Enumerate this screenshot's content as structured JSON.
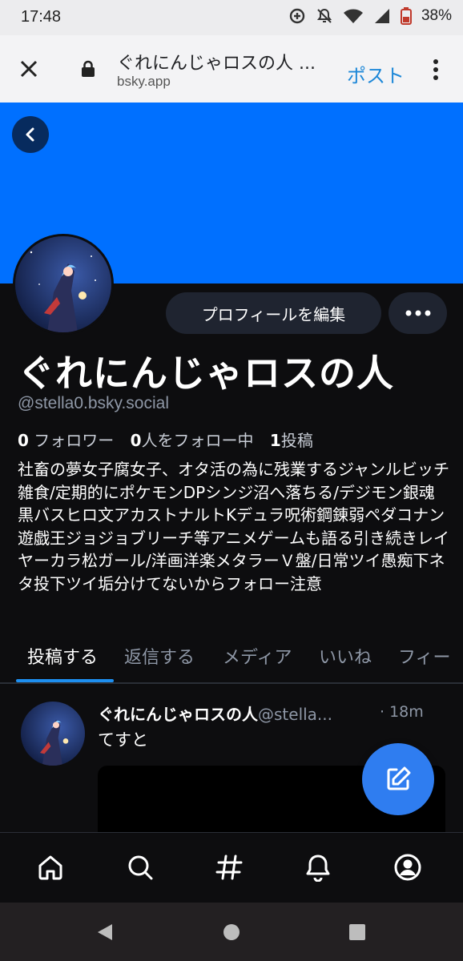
{
  "status_bar": {
    "time": "17:48",
    "battery": "38%",
    "icons": [
      "data-saver-icon",
      "notifications-off-icon",
      "wifi-icon",
      "cellular-signal-icon",
      "battery-icon"
    ]
  },
  "browser": {
    "page_title": "ぐれにんじゃロスの人 ...",
    "domain": "bsky.app",
    "action_label": "ポスト",
    "accent": "#1e88d8"
  },
  "banner": {
    "color": "#0070ff"
  },
  "profile": {
    "edit_button": "プロフィールを編集",
    "display_name": "ぐれにんじゃロスの人",
    "handle": "@stella0.bsky.social",
    "followers_count": "0",
    "followers_label": "フォロワー",
    "following_count": "0",
    "following_label": "人をフォロー中",
    "posts_count": "1",
    "posts_label": "投稿",
    "bio": "社畜の夢女子腐女子、オタ活の為に残業するジャンルビッチ雑食/定期的にポケモンDPシンジ沼へ落ちる/デジモン銀魂黒バスヒロ文アカストナルトKデュラ呪術鋼錬弱ペダコナン遊戯王ジョジョブリーチ等アニメゲームも語る引き続きレイヤーカラ松ガール/洋画洋楽メタラーＶ盤/日常ツイ愚痴下ネタ投下ツイ垢分けてないからフォロー注意"
  },
  "tabs": [
    {
      "label": "投稿する",
      "active": true
    },
    {
      "label": "返信する",
      "active": false
    },
    {
      "label": "メディア",
      "active": false
    },
    {
      "label": "いいね",
      "active": false
    },
    {
      "label": "フィー",
      "active": false
    }
  ],
  "post": {
    "author": "ぐれにんじゃロスの人",
    "handle": "@stella...",
    "time": "· 18m",
    "text": "てすと"
  },
  "bottom_nav": [
    "home-icon",
    "search-icon",
    "feeds-hash-icon",
    "notifications-bell-icon",
    "profile-icon"
  ],
  "android_nav": [
    "back-triangle-icon",
    "home-circle-icon",
    "recents-square-icon"
  ]
}
